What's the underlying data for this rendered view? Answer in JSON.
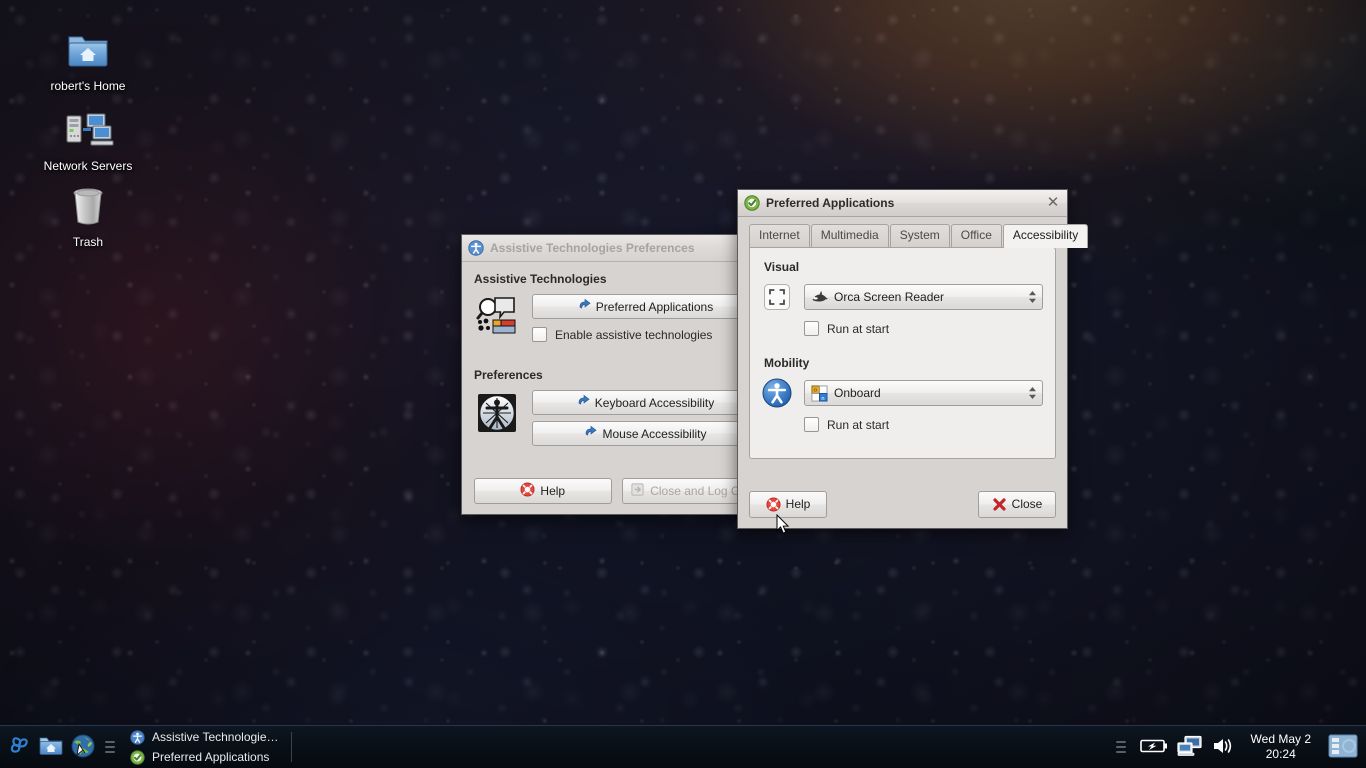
{
  "desktop": {
    "icons": [
      {
        "name": "home-folder",
        "label": "robert's Home",
        "icon": "home-folder-icon"
      },
      {
        "name": "network-servers",
        "label": "Network Servers",
        "icon": "network-servers-icon"
      },
      {
        "name": "trash",
        "label": "Trash",
        "icon": "trash-icon"
      }
    ],
    "wallpaper_colors": {
      "base": "#2e3152",
      "warm_highlight": "#f4ba82",
      "magenta": "#803448",
      "deep_blue": "#22253f"
    }
  },
  "assistive_window": {
    "title": "Assistive Technologies Preferences",
    "title_icon": "accessibility-icon",
    "active": false,
    "sections": {
      "assistive_technologies": {
        "label": "Assistive Technologies",
        "icon": "screen-reader-magnifier-icon",
        "preferred_applications_button": "Preferred Applications",
        "preferred_applications_button_icon": "link-arrow-icon",
        "enable_checkbox_label": "Enable assistive technologies",
        "enable_checkbox_checked": false
      },
      "preferences": {
        "label": "Preferences",
        "icon": "vitruvian-accessibility-icon",
        "keyboard_button": "Keyboard Accessibility",
        "keyboard_button_icon": "link-arrow-icon",
        "mouse_button": "Mouse Accessibility",
        "mouse_button_icon": "link-arrow-icon"
      }
    },
    "actions": {
      "help_label": "Help",
      "help_icon": "help-lifering-icon",
      "close_logout_label": "Close and Log Out",
      "close_logout_icon": "logout-icon",
      "close_logout_disabled": true
    }
  },
  "preferred_applications": {
    "title": "Preferred Applications",
    "title_icon": "green-check-circle-icon",
    "close_icon": "close-x-icon",
    "active": true,
    "tabs": [
      {
        "label": "Internet",
        "selected": false
      },
      {
        "label": "Multimedia",
        "selected": false
      },
      {
        "label": "System",
        "selected": false
      },
      {
        "label": "Office",
        "selected": false
      },
      {
        "label": "Accessibility",
        "selected": true
      }
    ],
    "groups": [
      {
        "label": "Visual",
        "icon": "screen-magnifier-bracket-icon",
        "combo": {
          "value": "Orca Screen Reader",
          "icon": "orca-whale-icon"
        },
        "checkbox": {
          "label": "Run at start",
          "checked": false
        }
      },
      {
        "label": "Mobility",
        "icon": "accessibility-person-icon",
        "combo": {
          "value": "Onboard",
          "icon": "onboard-keyboard-icon"
        },
        "checkbox": {
          "label": "Run at start",
          "checked": false
        }
      }
    ],
    "actions": {
      "help_label": "Help",
      "help_icon": "help-lifering-icon",
      "close_label": "Close",
      "close_icon": "red-x-icon"
    }
  },
  "taskbar": {
    "launchers": [
      {
        "name": "menu",
        "icon": "spiral-menu-icon"
      },
      {
        "name": "file-manager",
        "icon": "home-folder-icon"
      },
      {
        "name": "web-browser",
        "icon": "globe-browser-icon"
      }
    ],
    "tasks": [
      {
        "label": "Assistive Technologie…",
        "icon": "accessibility-icon"
      },
      {
        "label": "Preferred Applications",
        "icon": "green-check-circle-icon"
      }
    ],
    "tray": [
      {
        "name": "battery",
        "icon": "battery-charging-icon"
      },
      {
        "name": "network",
        "icon": "network-computers-icon"
      },
      {
        "name": "volume",
        "icon": "speaker-volume-icon"
      }
    ],
    "clock": {
      "date": "Wed May  2",
      "time": "20:24"
    },
    "show_desktop_icon": "show-desktop-icon"
  }
}
